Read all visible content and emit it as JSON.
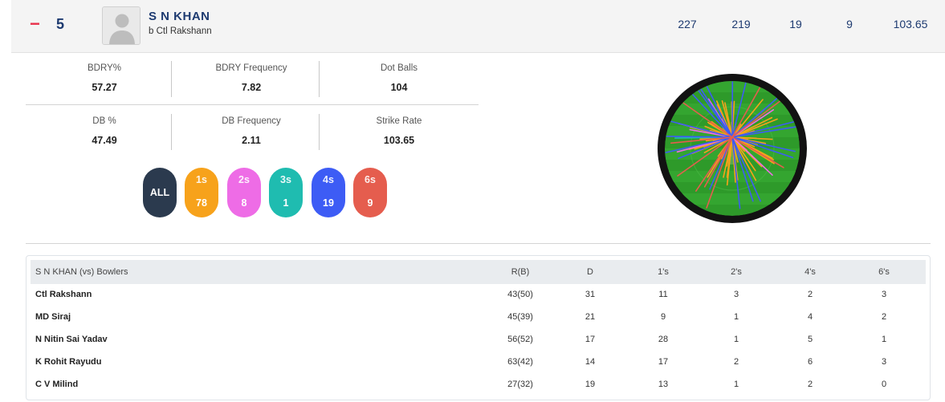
{
  "header": {
    "toggle": "−",
    "position": "5",
    "player_name": "S N KHAN",
    "dismissal": "b Ctl Rakshann",
    "stats": [
      "227",
      "219",
      "19",
      "9",
      "103.65"
    ]
  },
  "summary": [
    {
      "label": "BDRY%",
      "value": "57.27"
    },
    {
      "label": "BDRY Frequency",
      "value": "7.82"
    },
    {
      "label": "Dot Balls",
      "value": "104"
    },
    {
      "label": "DB %",
      "value": "47.49"
    },
    {
      "label": "DB Frequency",
      "value": "2.11"
    },
    {
      "label": "Strike Rate",
      "value": "103.65"
    }
  ],
  "filters": [
    {
      "label": "ALL",
      "count": "",
      "color": "#2b3a4e"
    },
    {
      "label": "1s",
      "count": "78",
      "color": "#f7a21b"
    },
    {
      "label": "2s",
      "count": "8",
      "color": "#ee6ce6"
    },
    {
      "label": "3s",
      "count": "1",
      "color": "#1fbcb0"
    },
    {
      "label": "4s",
      "count": "19",
      "color": "#3d5cf5"
    },
    {
      "label": "6s",
      "count": "9",
      "color": "#e55d4e"
    }
  ],
  "wheel": {
    "field_color": "#2e9a2a",
    "border_color": "#111111"
  },
  "table": {
    "headers": [
      "S N KHAN (vs) Bowlers",
      "R(B)",
      "D",
      "1's",
      "2's",
      "4's",
      "6's"
    ],
    "rows": [
      [
        "Ctl Rakshann",
        "43(50)",
        "31",
        "11",
        "3",
        "2",
        "3"
      ],
      [
        "MD Siraj",
        "45(39)",
        "21",
        "9",
        "1",
        "4",
        "2"
      ],
      [
        "N Nitin Sai Yadav",
        "56(52)",
        "17",
        "28",
        "1",
        "5",
        "1"
      ],
      [
        "K Rohit Rayudu",
        "63(42)",
        "14",
        "17",
        "2",
        "6",
        "3"
      ],
      [
        "C V Milind",
        "27(32)",
        "19",
        "13",
        "1",
        "2",
        "0"
      ]
    ]
  }
}
